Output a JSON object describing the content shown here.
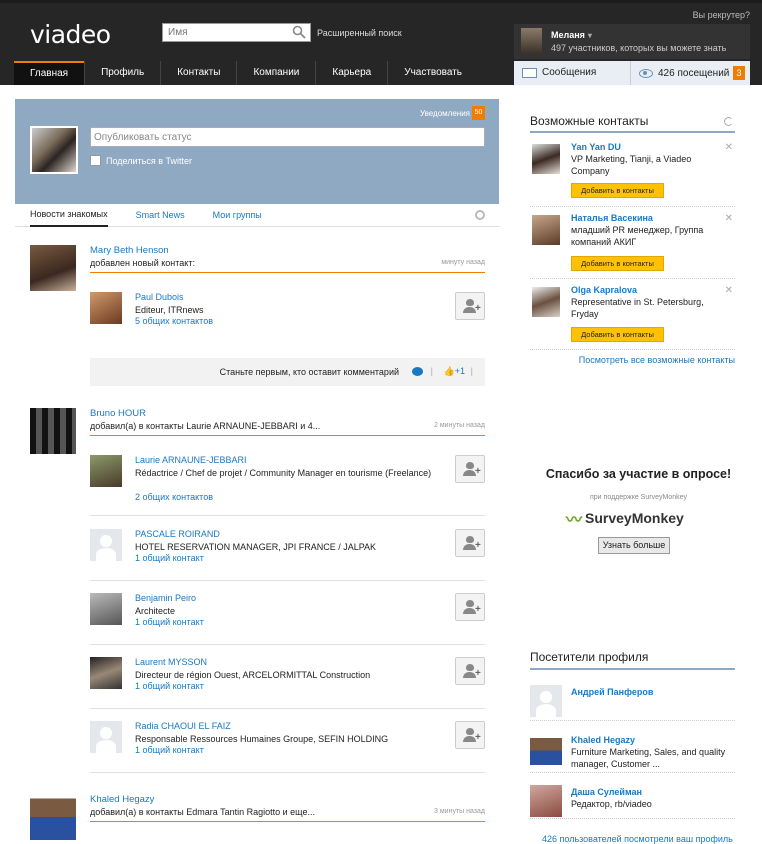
{
  "header": {
    "logo": "viadeo",
    "search_placeholder": "Имя",
    "advanced_search": "Расширенный поиск",
    "recruiter_link": "Вы рекрутер?",
    "user_name": "Меланя",
    "user_sub": "497 участников, которых вы можете знать"
  },
  "nav": [
    {
      "label": "Главная"
    },
    {
      "label": "Профиль"
    },
    {
      "label": "Контакты"
    },
    {
      "label": "Компании"
    },
    {
      "label": "Карьера"
    },
    {
      "label": "Участвовать"
    }
  ],
  "msgbar": {
    "messages": "Сообщения",
    "visits": "426 посещений",
    "visits_badge": "3"
  },
  "status": {
    "notifications_label": "Уведомления",
    "notifications_count": "50",
    "placeholder": "Опубликовать статус",
    "twitter_label": "Поделиться в Twitter"
  },
  "feed_tabs": [
    {
      "label": "Новости знакомых"
    },
    {
      "label": "Smart News"
    },
    {
      "label": "Мои группы"
    }
  ],
  "feed": [
    {
      "actor": "Mary Beth Henson",
      "action": "добавлен новый контакт:",
      "time": "минуту назад",
      "contacts": [
        {
          "name": "Paul Dubois",
          "title": "Editeur, ITRnews",
          "common": "5 общих контактов"
        }
      ],
      "comment_prompt": "Станьте первым, кто оставит комментарий",
      "like": "+1"
    },
    {
      "actor": "Bruno HOUR",
      "action": "добавил(а) в контакты Laurie ARNAUNE-JEBBARI и 4...",
      "time": "2 минуты назад",
      "contacts": [
        {
          "name": "Laurie ARNAUNE-JEBBARI",
          "title": "Rédactrice / Chef de projet / Community Manager en tourisme (Freelance)",
          "common": "2 общих контактов"
        },
        {
          "name": "PASCALE ROIRAND",
          "title": "HOTEL RESERVATION MANAGER, JPI FRANCE / JALPAK",
          "common": "1 общий контакт"
        },
        {
          "name": "Benjamin Peiro",
          "title": "Architecte",
          "common": "1 общий контакт"
        },
        {
          "name": "Laurent MYSSON",
          "title": "Directeur de région Ouest, ARCELORMITTAL Construction",
          "common": "1 общий контакт"
        },
        {
          "name": "Radia CHAOUI EL FAIZ",
          "title": "Responsable Ressources Humaines Groupe, SEFIN HOLDING",
          "common": "1 общий контакт"
        }
      ]
    },
    {
      "actor": "Khaled Hegazy",
      "action": "добавил(а) в контакты Edmara Tantin Ragiotto и еще...",
      "time": "3 минуты назад"
    }
  ],
  "right": {
    "suggestions_title": "Возможные контакты",
    "suggestions": [
      {
        "name": "Yan Yan DU",
        "title": "VP Marketing, Tianji, a Viadeo Company",
        "button": "Добавить в контакты"
      },
      {
        "name": "Наталья Васекина",
        "title": "младший PR менеджер, Группа компаний АКИГ",
        "button": "Добавить в контакты"
      },
      {
        "name": "Olga Kapralova",
        "title": "Representative in St. Petersburg, Fryday",
        "button": "Добавить в контакты"
      }
    ],
    "see_all": "Посмотреть все возможные контакты",
    "survey_title": "Спасибо за участие в опросе!",
    "survey_sub": "при поддержке SurveyMonkey",
    "survey_logo": "SurveyMonkey",
    "survey_button": "Узнать больше",
    "visitors_title": "Посетители профиля",
    "visitors": [
      {
        "name": "Андрей Панферов",
        "title": ""
      },
      {
        "name": "Khaled Hegazy",
        "title": "Furniture Marketing, Sales, and quality manager, Customer ..."
      },
      {
        "name": "Даша Сулейман",
        "title": "Редактор, rb/viadeo"
      }
    ],
    "visitors_more": "426 пользователей посмотрели ваш профиль"
  },
  "colors": {
    "accent": "#f07d00",
    "link": "#1a78c2",
    "panel": "#8fa9c3",
    "header": "#262626",
    "button_yellow": "#ffc107"
  }
}
